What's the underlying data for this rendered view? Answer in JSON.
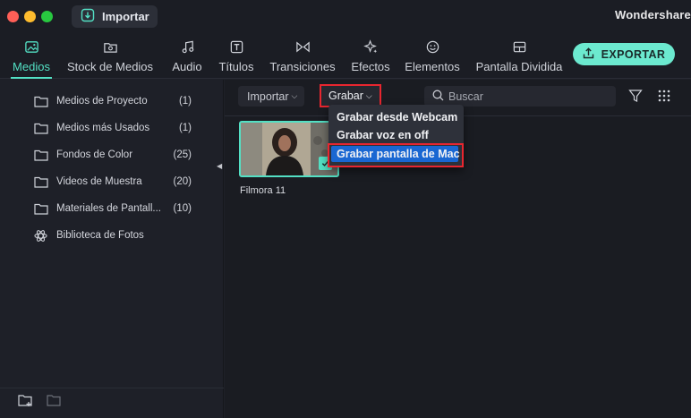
{
  "titlebar": {
    "import_button": "Importar",
    "brand": "Wondershare"
  },
  "tabs": [
    {
      "label": "Medios",
      "icon": "media-image-icon",
      "active": true
    },
    {
      "label": "Stock de Medios",
      "icon": "folder-stock-icon",
      "active": false
    },
    {
      "label": "Audio",
      "icon": "music-note-icon",
      "active": false
    },
    {
      "label": "Títulos",
      "icon": "title-text-icon",
      "active": false
    },
    {
      "label": "Transiciones",
      "icon": "transition-icon",
      "active": false
    },
    {
      "label": "Efectos",
      "icon": "sparkle-icon",
      "active": false
    },
    {
      "label": "Elementos",
      "icon": "smiley-icon",
      "active": false
    },
    {
      "label": "Pantalla Dividida",
      "icon": "split-screen-icon",
      "active": false
    }
  ],
  "export_button": "EXPORTAR",
  "sidebar": {
    "items": [
      {
        "label": "Medios de Proyecto",
        "count": "(1)",
        "icon": "folder-icon"
      },
      {
        "label": "Medios más Usados",
        "count": "(1)",
        "icon": "folder-icon"
      },
      {
        "label": "Fondos de Color",
        "count": "(25)",
        "icon": "folder-icon"
      },
      {
        "label": "Videos de Muestra",
        "count": "(20)",
        "icon": "folder-icon"
      },
      {
        "label": "Materiales de Pantall...",
        "count": "(10)",
        "icon": "folder-icon"
      },
      {
        "label": "Biblioteca de Fotos",
        "count": "",
        "icon": "atom-icon"
      }
    ]
  },
  "media_toolbar": {
    "import_dropdown": "Importar",
    "record_dropdown": "Grabar",
    "search_placeholder": "Buscar"
  },
  "media": [
    {
      "name": "Filmora 11"
    }
  ],
  "record_menu": {
    "items": [
      {
        "label": "Grabar desde Webcam",
        "selected": false
      },
      {
        "label": "Grabar voz en off",
        "selected": false
      },
      {
        "label": "Grabar pantalla de Mac",
        "selected": true
      }
    ]
  },
  "colors": {
    "accent": "#53e0c4",
    "highlight_box": "#e8262f",
    "menu_selection": "#1967d2"
  }
}
